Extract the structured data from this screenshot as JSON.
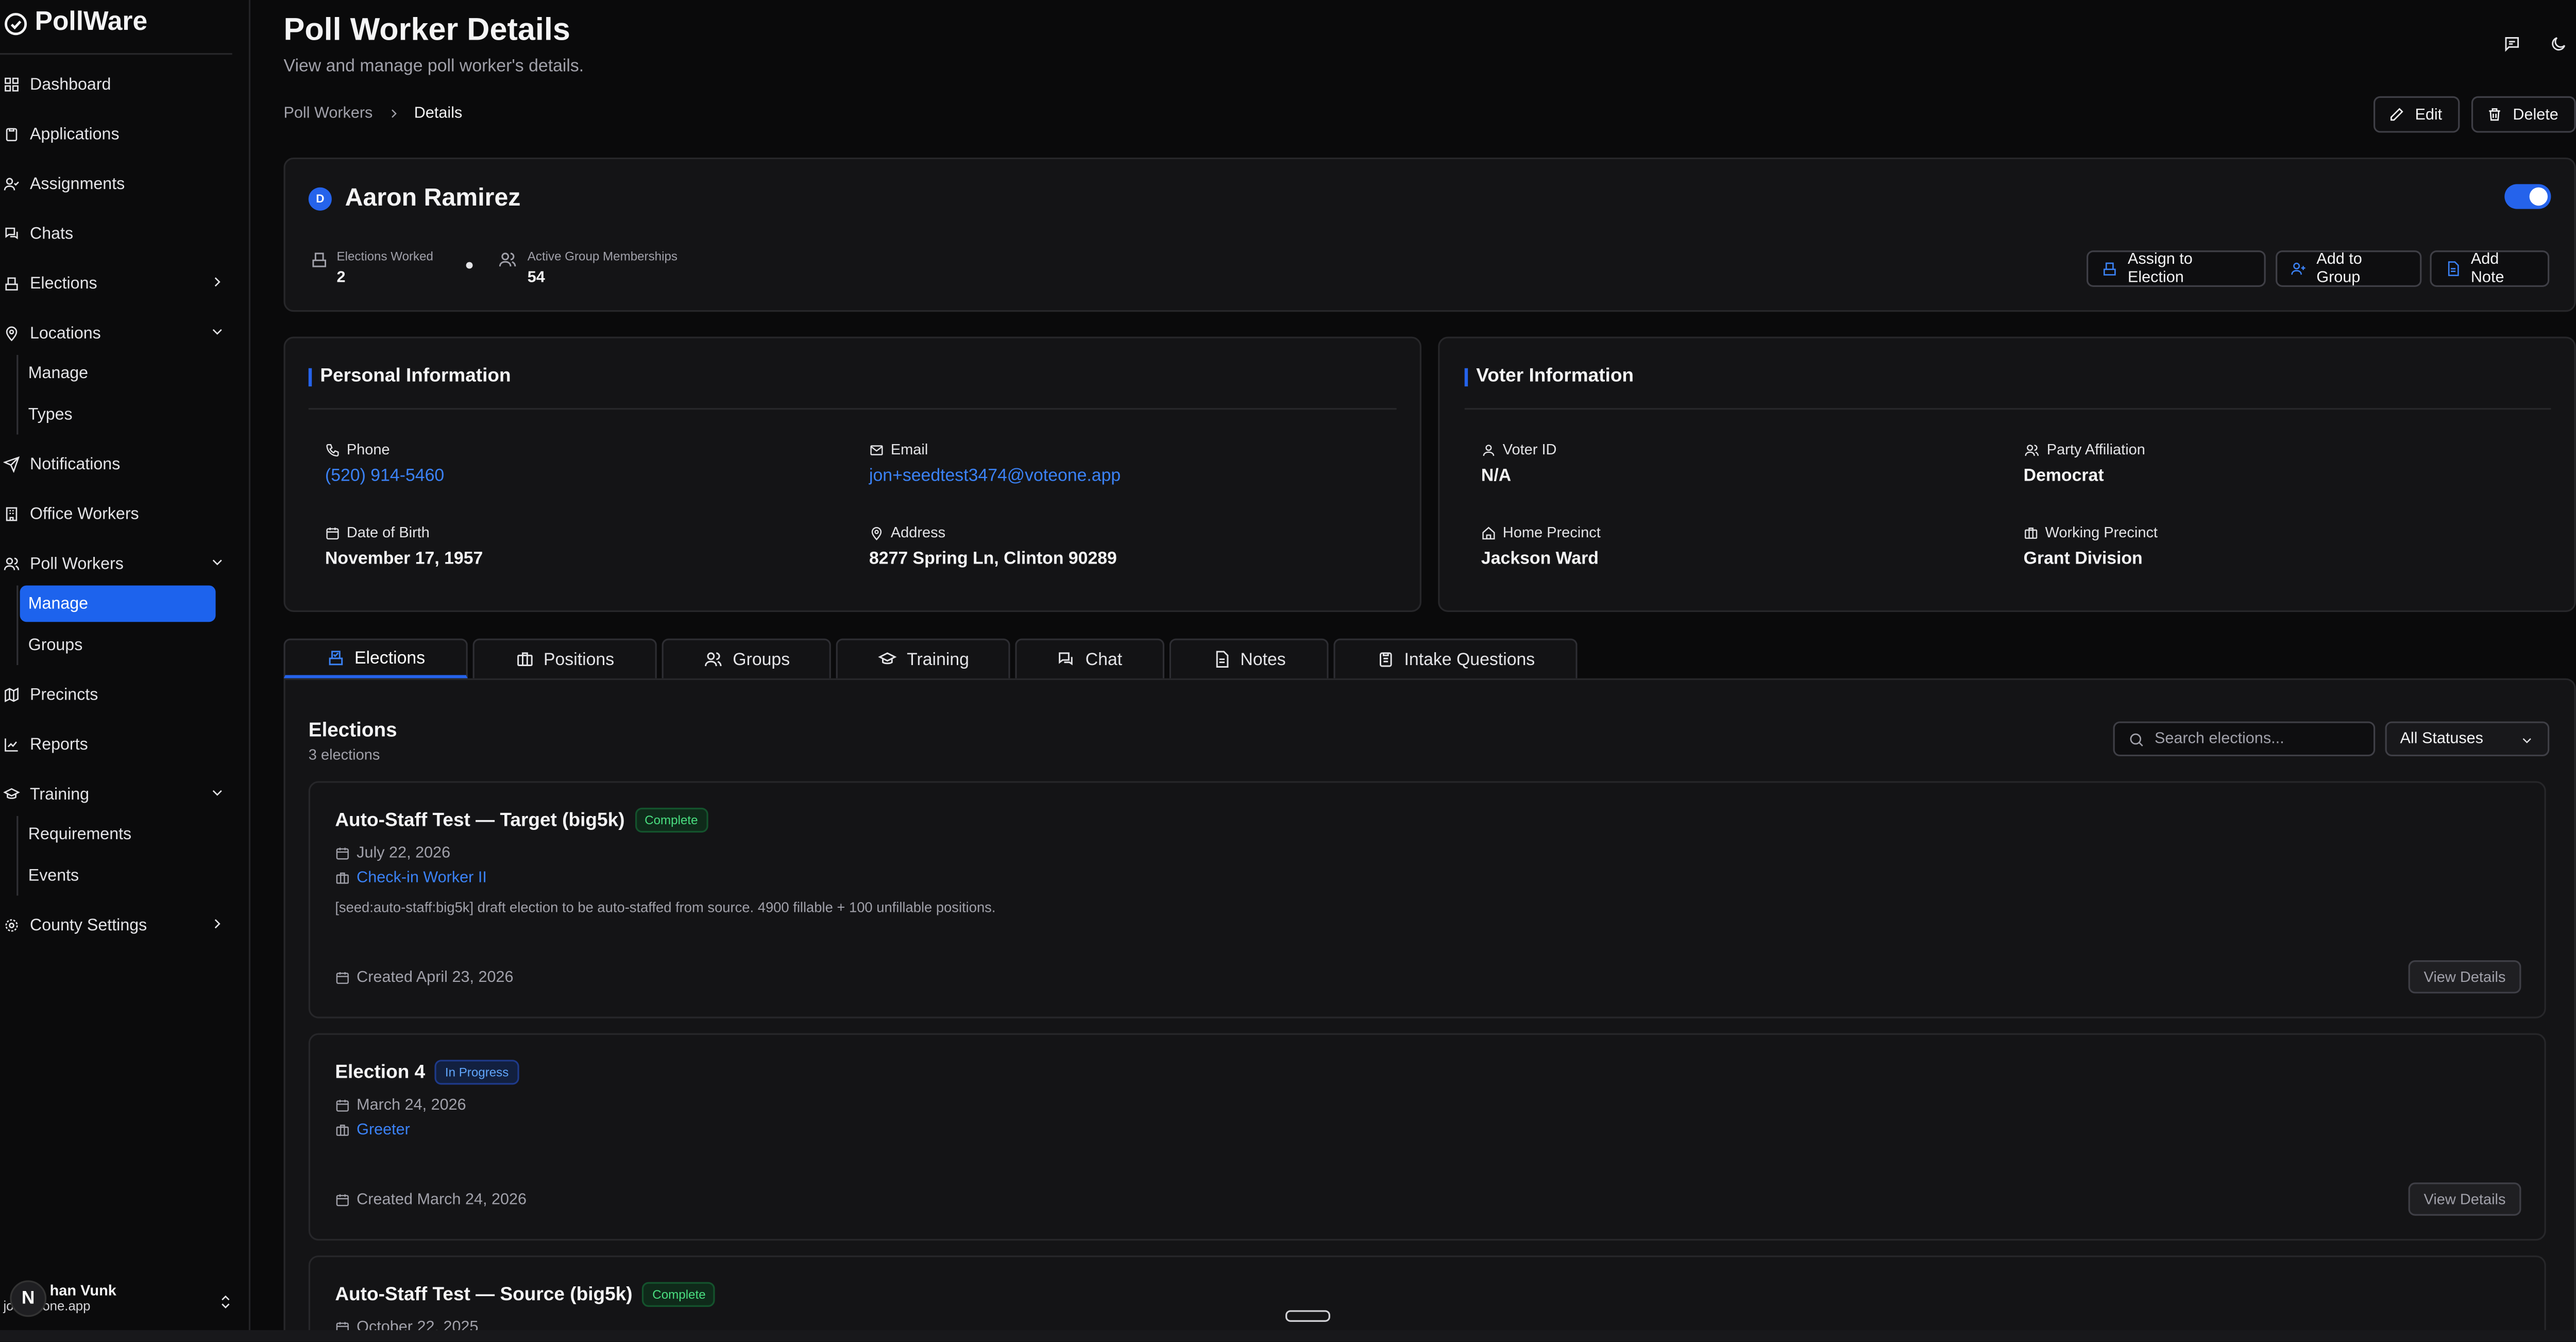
{
  "app": {
    "name": "PollWare"
  },
  "sidebar": {
    "items": [
      {
        "label": "Dashboard"
      },
      {
        "label": "Applications"
      },
      {
        "label": "Assignments"
      },
      {
        "label": "Chats"
      },
      {
        "label": "Elections"
      },
      {
        "label": "Locations",
        "children": [
          {
            "label": "Manage"
          },
          {
            "label": "Types"
          }
        ]
      },
      {
        "label": "Notifications"
      },
      {
        "label": "Office Workers"
      },
      {
        "label": "Poll Workers",
        "children": [
          {
            "label": "Manage"
          },
          {
            "label": "Groups"
          }
        ]
      },
      {
        "label": "Precincts"
      },
      {
        "label": "Reports"
      },
      {
        "label": "Training",
        "children": [
          {
            "label": "Requirements"
          },
          {
            "label": "Events"
          }
        ]
      },
      {
        "label": "County Settings"
      }
    ],
    "user": {
      "initial": "N",
      "name": "han Vunk",
      "email": "jo  voteone.app"
    }
  },
  "header": {
    "title": "Poll Worker Details",
    "subtitle": "View and manage poll worker's details.",
    "breadcrumb": [
      "Poll Workers",
      "Details"
    ],
    "edit_label": "Edit",
    "delete_label": "Delete"
  },
  "worker": {
    "party_initial": "D",
    "name": "Aaron Ramirez",
    "active": true,
    "stats": [
      {
        "label": "Elections Worked",
        "value": "2"
      },
      {
        "label": "Active Group Memberships",
        "value": "54"
      }
    ],
    "actions": {
      "assign": "Assign to Election",
      "group": "Add to Group",
      "note": "Add Note"
    }
  },
  "personal": {
    "title": "Personal Information",
    "phone_label": "Phone",
    "phone": "(520) 914-5460",
    "email_label": "Email",
    "email": "jon+seedtest3474@voteone.app",
    "dob_label": "Date of Birth",
    "dob": "November 17, 1957",
    "address_label": "Address",
    "address": "8277 Spring Ln, Clinton 90289"
  },
  "voter": {
    "title": "Voter Information",
    "voter_id_label": "Voter ID",
    "voter_id": "N/A",
    "party_label": "Party Affiliation",
    "party": "Democrat",
    "home_label": "Home Precinct",
    "home": "Jackson Ward",
    "working_label": "Working Precinct",
    "working": "Grant Division"
  },
  "tabs": [
    "Elections",
    "Positions",
    "Groups",
    "Training",
    "Chat",
    "Notes",
    "Intake Questions"
  ],
  "elections": {
    "title": "Elections",
    "count": "3 elections",
    "search_placeholder": "Search elections...",
    "status_filter": "All Statuses",
    "view_label": "View Details",
    "items": [
      {
        "name": "Auto-Staff Test — Target (big5k)",
        "status": "Complete",
        "date": "July 22, 2026",
        "position": "Check-in Worker II",
        "description": "[seed:auto-staff:big5k] draft election to be auto-staffed from source. 4900 fillable + 100 unfillable positions.",
        "created": "Created April 23, 2026"
      },
      {
        "name": "Election 4",
        "status": "In Progress",
        "date": "March 24, 2026",
        "position": "Greeter",
        "created": "Created March 24, 2026"
      },
      {
        "name": "Auto-Staff Test — Source (big5k)",
        "status": "Complete",
        "date": "October 22, 2025"
      }
    ]
  },
  "colors": {
    "accent": "#2563eb",
    "link": "#3b82f6",
    "complete": "#4ade80",
    "background": "#0a0a0b",
    "card": "#141416"
  }
}
